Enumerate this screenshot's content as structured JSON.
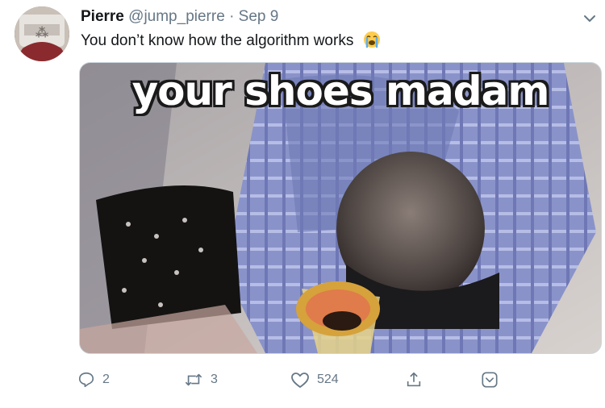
{
  "tweet": {
    "author_name": "Pierre",
    "author_handle": "@jump_pierre",
    "separator": "·",
    "date": "Sep 9",
    "text": "You don’t know how the algorithm works",
    "emoji": "loudly-crying-face"
  },
  "media": {
    "caption": "your shoes madam"
  },
  "actions": {
    "reply_count": "2",
    "retweet_count": "3",
    "like_count": "524"
  },
  "colors": {
    "text_primary": "#14171a",
    "text_secondary": "#657786",
    "border": "#ccd6dd"
  },
  "icons": [
    "caret-down-icon",
    "reply-icon",
    "retweet-icon",
    "like-icon",
    "share-icon",
    "bookmark-icon"
  ]
}
